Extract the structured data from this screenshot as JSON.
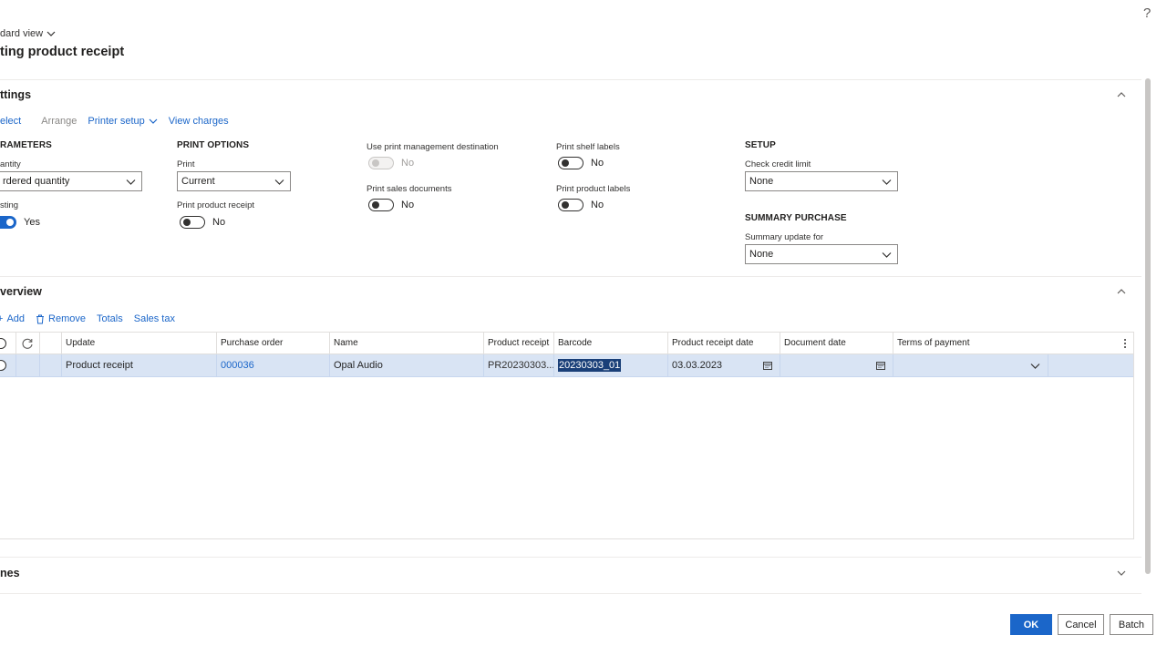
{
  "header": {
    "view_label": "dard view",
    "page_title": "ting product receipt",
    "help": "?"
  },
  "settings": {
    "title": "ttings",
    "toolbar": {
      "select": "elect",
      "arrange": "Arrange",
      "printer_setup": "Printer setup",
      "view_charges": "View charges"
    },
    "parameters": {
      "title": "RAMETERS",
      "quantity_label": "antity",
      "quantity_value": "rdered quantity",
      "posting_label": "sting",
      "posting_value": "Yes"
    },
    "print_options": {
      "title": "PRINT OPTIONS",
      "print_label": "Print",
      "print_value": "Current",
      "print_receipt_label": "Print product receipt",
      "print_receipt_value": "No"
    },
    "print_mgmt": {
      "use_pm_label": "Use print management destination",
      "use_pm_value": "No",
      "print_sales_docs_label": "Print sales documents",
      "print_sales_docs_value": "No"
    },
    "labels": {
      "shelf_label": "Print shelf labels",
      "shelf_value": "No",
      "product_labels_label": "Print product labels",
      "product_labels_value": "No"
    },
    "setup": {
      "title": "SETUP",
      "credit_label": "Check credit limit",
      "credit_value": "None"
    },
    "summary": {
      "title": "SUMMARY PURCHASE",
      "update_label": "Summary update for",
      "update_value": "None"
    }
  },
  "overview": {
    "title": "verview",
    "toolbar": {
      "add": "Add",
      "remove": "Remove",
      "totals": "Totals",
      "sales_tax": "Sales tax"
    },
    "columns": {
      "update": "Update",
      "purchase_order": "Purchase order",
      "name": "Name",
      "product_receipt": "Product receipt",
      "barcode": "Barcode",
      "receipt_date": "Product receipt date",
      "document_date": "Document date",
      "terms": "Terms of payment"
    },
    "rows": [
      {
        "update": "Product receipt",
        "purchase_order": "000036",
        "name": "Opal Audio",
        "product_receipt": "PR20230303...",
        "barcode": "20230303_01",
        "receipt_date": "03.03.2023",
        "document_date": "",
        "terms": ""
      }
    ]
  },
  "lines": {
    "title": "nes"
  },
  "footer": {
    "ok": "OK",
    "cancel": "Cancel",
    "batch": "Batch"
  },
  "colors": {
    "accent": "#1b66c9",
    "selected_row": "#d9e4f4"
  }
}
